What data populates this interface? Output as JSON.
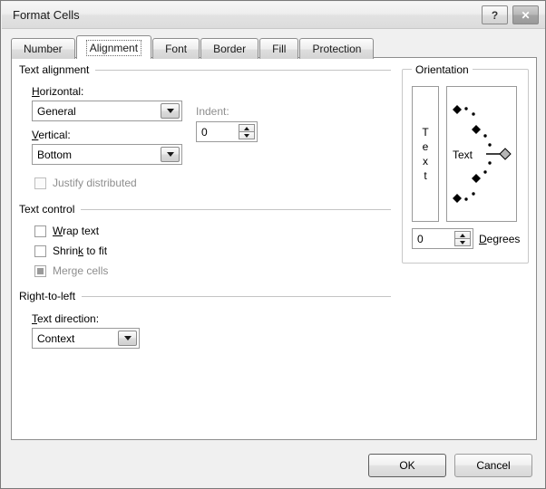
{
  "window": {
    "title": "Format Cells",
    "help_button": "?",
    "close_button": "✕"
  },
  "tabs": [
    {
      "label": "Number",
      "active": false
    },
    {
      "label": "Alignment",
      "active": true
    },
    {
      "label": "Font",
      "active": false
    },
    {
      "label": "Border",
      "active": false
    },
    {
      "label": "Fill",
      "active": false
    },
    {
      "label": "Protection",
      "active": false
    }
  ],
  "text_alignment": {
    "group_label": "Text alignment",
    "horizontal_label_pre": "H",
    "horizontal_label_post": "orizontal:",
    "horizontal_value": "General",
    "vertical_label_pre": "V",
    "vertical_label_post": "ertical:",
    "vertical_value": "Bottom",
    "indent_label": "Indent:",
    "indent_value": "0",
    "justify_distributed_label": "Justify distributed",
    "justify_distributed_checked": false,
    "justify_distributed_enabled": false
  },
  "text_control": {
    "group_label": "Text control",
    "wrap_text_pre": "W",
    "wrap_text_post": "rap text",
    "wrap_text_checked": false,
    "shrink_pre": "Shrin",
    "shrink_mnemonic": "k",
    "shrink_post": " to fit",
    "shrink_checked": false,
    "merge_cells_label": "Merge cells",
    "merge_cells_state": "mixed"
  },
  "right_to_left": {
    "group_label": "Right-to-left",
    "text_direction_pre": "T",
    "text_direction_post": "ext direction:",
    "text_direction_value": "Context"
  },
  "orientation": {
    "group_label": "Orientation",
    "vertical_preview_letters": [
      "T",
      "e",
      "x",
      "t"
    ],
    "dial_label": "Text",
    "degrees_value": "0",
    "degrees_label_pre": "D",
    "degrees_label_post": "egrees",
    "selected_angle": 0,
    "major_ticks": [
      90,
      45,
      0,
      -45,
      -90
    ],
    "minor_ticks": [
      75,
      60,
      30,
      15,
      -15,
      -30,
      -60,
      -75
    ]
  },
  "footer": {
    "ok_label": "OK",
    "cancel_label": "Cancel"
  },
  "colors": {
    "dialog_bg": "#f0f0f0",
    "panel_bg": "#ffffff",
    "border": "#8d8d8d",
    "disabled_text": "#8e8e8e",
    "group_rule": "#c4c4c4"
  }
}
